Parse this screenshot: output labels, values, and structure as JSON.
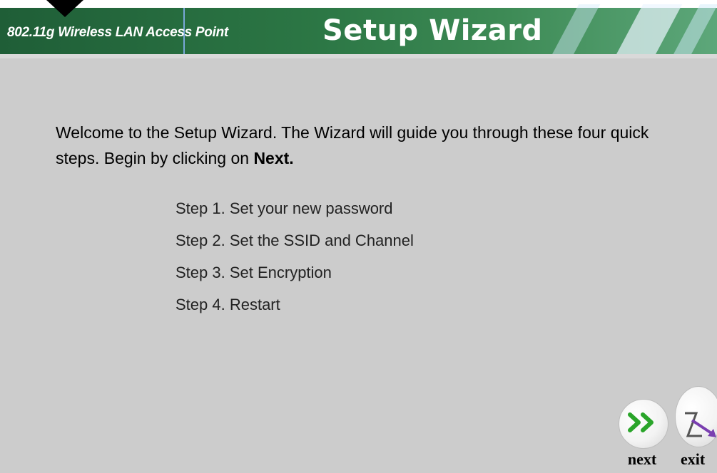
{
  "header": {
    "subtitle": "802.11g Wireless LAN Access Point",
    "title": "Setup Wizard"
  },
  "intro": {
    "text": "Welcome to the Setup Wizard. The Wizard will guide you through these four quick steps. Begin by clicking on ",
    "bold": "Next."
  },
  "steps": [
    "Step 1. Set your new password",
    "Step 2. Set the SSID and Channel",
    "Step 3. Set Encryption",
    "Step 4. Restart"
  ],
  "buttons": {
    "next_label": "next",
    "exit_label": "exit"
  },
  "icons": {
    "next": "double-chevron-right-icon",
    "exit": "exit-door-icon",
    "pointer": "pointer-arrow-icon"
  },
  "colors": {
    "header_green": "#2c7745",
    "page_background": "#cccccc",
    "next_arrow": "#2aa52a",
    "exit_arrow": "#7a3fb0"
  }
}
